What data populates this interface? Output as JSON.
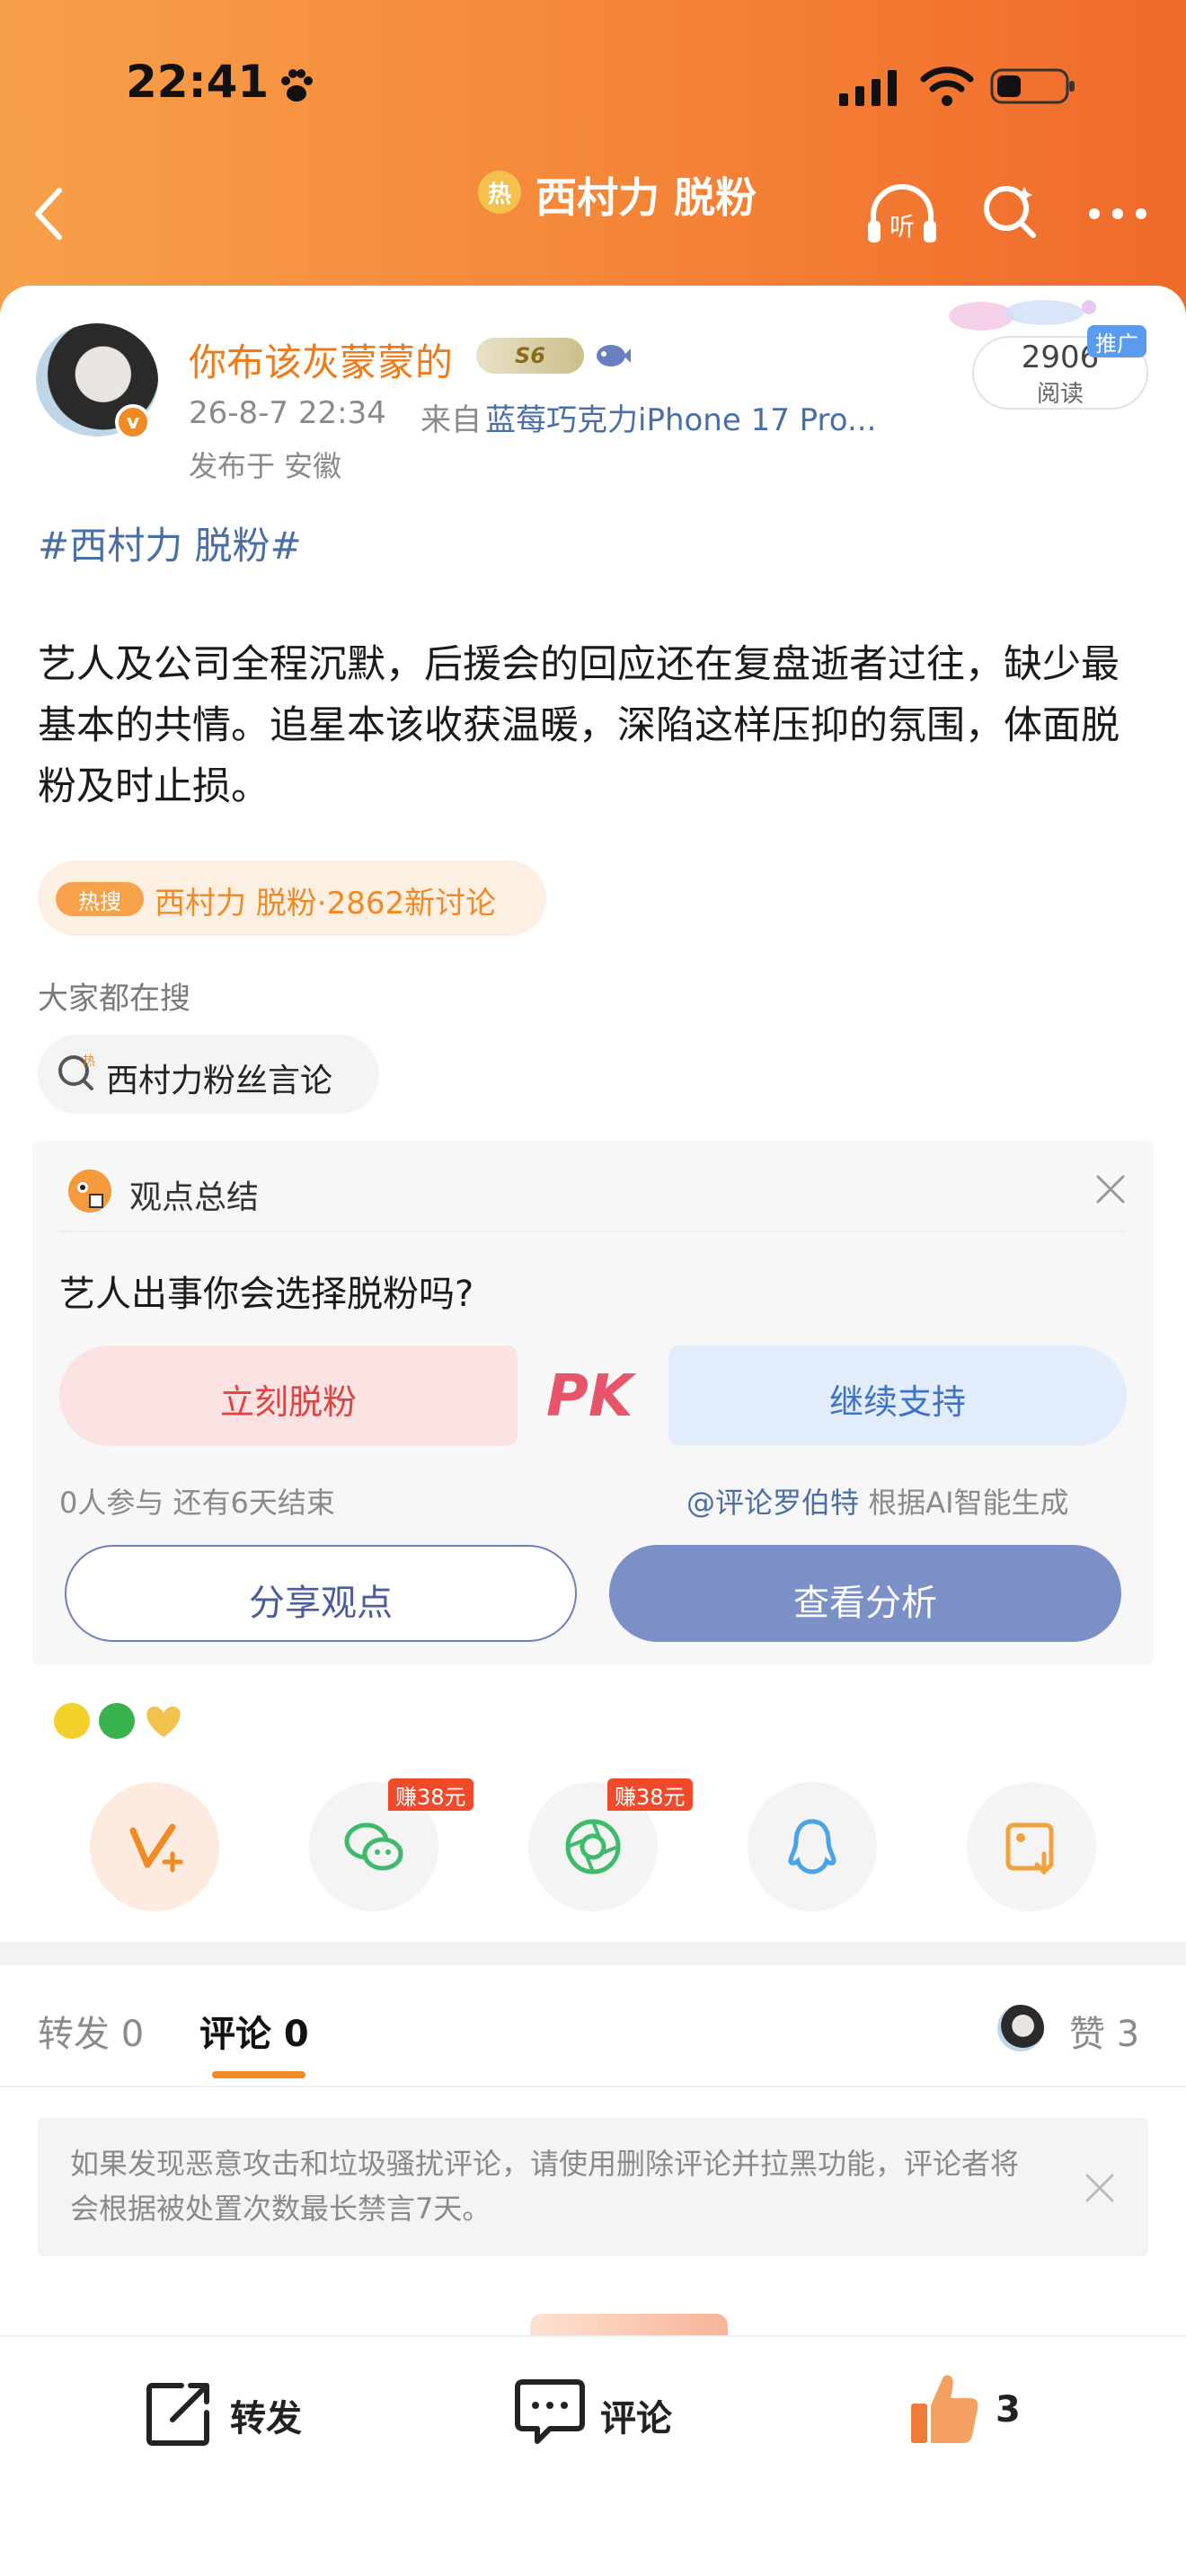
{
  "status_bar": {
    "time": "22:41"
  },
  "nav": {
    "hot_badge": "热",
    "title": "西村力 脱粉",
    "listen_label": "听"
  },
  "post": {
    "username": "你布该灰蒙蒙的",
    "level": "S6",
    "time": "26-8-7 22:34",
    "from_prefix": "来自",
    "device": "蓝莓巧克力iPhone 17 Pro...",
    "location": "发布于 安徽",
    "read_count": "2906",
    "read_label": "阅读",
    "promo_tag": "推广",
    "topic": "#西村力 脱粉#",
    "body": "艺人及公司全程沉默，后援会的回应还在复盘逝者过往，缺少最基本的共情。追星本该收获温暖，深陷这样压抑的氛围，体面脱粉及时止损。"
  },
  "hot_search": {
    "tag": "热搜",
    "text": "西村力 脱粉·2862新讨论"
  },
  "everyone_search": {
    "title": "大家都在搜",
    "chip": "西村力粉丝言论",
    "chip_icon_char": "热"
  },
  "opinion": {
    "title": "观点总结",
    "question": "艺人出事你会选择脱粉吗?",
    "option_left": "立刻脱粉",
    "pk": "PK",
    "option_right": "继续支持",
    "participants": "0人参与  还有6天结束",
    "credit_link": "@评论罗伯特",
    "credit_suffix": " 根据AI智能生成",
    "share_button": "分享观点",
    "analysis_button": "查看分析"
  },
  "share": {
    "earn_badge_1": "赚38元",
    "earn_badge_2": "赚38元"
  },
  "tabs": {
    "repost": "转发 0",
    "comment": "评论 0",
    "like": "赞 3"
  },
  "notice": {
    "text": "如果发现恶意攻击和垃圾骚扰评论，请使用删除评论并拉黑功能，评论者将会根据被处置次数最长禁言7天。"
  },
  "bottom_bar": {
    "repost": "转发",
    "comment": "评论",
    "like_count": "3"
  },
  "colors": {
    "accent": "#f08a24",
    "link": "#4a6fa5",
    "header_start": "#f7a04a",
    "header_end": "#f06a2a"
  }
}
